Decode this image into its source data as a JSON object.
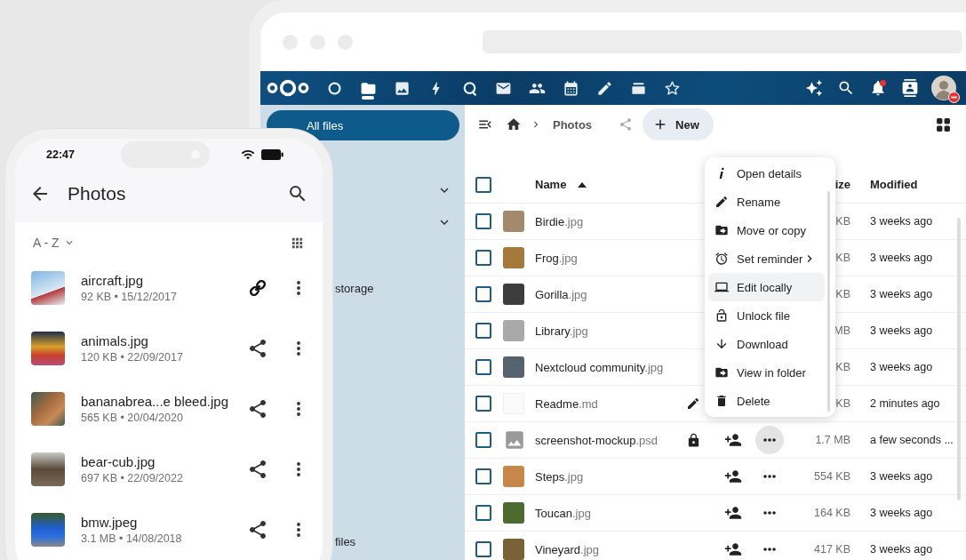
{
  "browser": {
    "header": {
      "apps": [
        {
          "selected": false
        },
        {
          "selected": true
        },
        {
          "selected": false
        },
        {
          "selected": false
        },
        {
          "selected": false
        },
        {
          "selected": false
        },
        {
          "selected": false
        },
        {
          "selected": false
        },
        {
          "selected": false
        },
        {
          "selected": false
        },
        {
          "selected": false
        }
      ],
      "notifications_unread": true,
      "do_not_disturb": true
    },
    "sidebar": {
      "items": [
        {
          "kind": "link",
          "label": "All files",
          "selected": true
        },
        {
          "kind": "group",
          "expanded": false,
          "selected": false
        },
        {
          "kind": "group",
          "expanded": false,
          "selected": false
        },
        {
          "kind": "link",
          "label": "storage",
          "selected": false
        },
        {
          "kind": "footer",
          "label": "files",
          "selected": false
        }
      ]
    },
    "toolbar": {
      "breadcrumb": "Photos",
      "new_button": "New"
    },
    "table": {
      "select_all": {
        "checked": false
      },
      "columns": [
        {
          "label": "Name",
          "sorted": true
        },
        {
          "label": "ize",
          "sorted": false
        },
        {
          "label": "Modified",
          "sorted": false
        }
      ],
      "rows": [
        {
          "checked": false,
          "kind": "photo",
          "name": "Birdie",
          "ext": ".jpg",
          "locked": false,
          "editing": false,
          "menu_open": false,
          "size": "KB",
          "modified": "3 weeks ago"
        },
        {
          "checked": false,
          "kind": "photo",
          "name": "Frog",
          "ext": ".jpg",
          "locked": false,
          "editing": false,
          "menu_open": false,
          "size": "KB",
          "modified": "3 weeks ago"
        },
        {
          "checked": false,
          "kind": "photo",
          "name": "Gorilla",
          "ext": ".jpg",
          "locked": false,
          "editing": false,
          "menu_open": false,
          "size": "KB",
          "modified": "3 weeks ago"
        },
        {
          "checked": false,
          "kind": "photo",
          "name": "Library",
          "ext": ".jpg",
          "locked": false,
          "editing": false,
          "menu_open": false,
          "size": "MB",
          "modified": "3 weeks ago"
        },
        {
          "checked": false,
          "kind": "photo",
          "name": "Nextcloud community",
          "ext": ".jpg",
          "locked": false,
          "editing": false,
          "menu_open": false,
          "size": "KB",
          "modified": "3 weeks ago"
        },
        {
          "checked": false,
          "kind": "document",
          "name": "Readme",
          "ext": ".md",
          "locked": false,
          "editing": true,
          "menu_open": false,
          "size": "KB",
          "modified": "2 minutes ago"
        },
        {
          "checked": false,
          "kind": "image",
          "name": "screenshot-mockup",
          "ext": ".psd",
          "locked": true,
          "editing": false,
          "menu_open": true,
          "size": "1.7 MB",
          "modified": "a few seconds ..."
        },
        {
          "checked": false,
          "kind": "photo",
          "name": "Steps",
          "ext": ".jpg",
          "locked": false,
          "editing": false,
          "menu_open": false,
          "size": "554 KB",
          "modified": "3 weeks ago"
        },
        {
          "checked": false,
          "kind": "photo",
          "name": "Toucan",
          "ext": ".jpg",
          "locked": false,
          "editing": false,
          "menu_open": false,
          "size": "164 KB",
          "modified": "3 weeks ago"
        },
        {
          "checked": false,
          "kind": "photo",
          "name": "Vineyard",
          "ext": ".jpg",
          "locked": false,
          "editing": false,
          "menu_open": false,
          "size": "417 KB",
          "modified": "3 weeks ago"
        }
      ]
    },
    "context_menu": {
      "items": [
        {
          "label": "Open details",
          "highlighted": false,
          "submenu": false
        },
        {
          "label": "Rename",
          "highlighted": false,
          "submenu": false
        },
        {
          "label": "Move or copy",
          "highlighted": false,
          "submenu": false
        },
        {
          "label": "Set reminder",
          "highlighted": false,
          "submenu": true
        },
        {
          "label": "Edit locally",
          "highlighted": true,
          "submenu": false
        },
        {
          "label": "Unlock file",
          "highlighted": false,
          "submenu": false
        },
        {
          "label": "Download",
          "highlighted": false,
          "submenu": false
        },
        {
          "label": "View in folder",
          "highlighted": false,
          "submenu": false
        },
        {
          "label": "Delete",
          "highlighted": false,
          "submenu": false
        }
      ]
    }
  },
  "phone": {
    "status_time": "22:47",
    "title": "Photos",
    "sort_label": "A - Z",
    "files": [
      {
        "name": "aircraft.jpg",
        "meta": "92 KB • 15/12/2017",
        "link_shared": true
      },
      {
        "name": "animals.jpg",
        "meta": "120 KB • 22/09/2017",
        "link_shared": false
      },
      {
        "name": "bananabrea...e bleed.jpg",
        "meta": "565 KB • 20/04/2020",
        "link_shared": false
      },
      {
        "name": "bear-cub.jpg",
        "meta": "697 KB • 22/09/2022",
        "link_shared": false
      },
      {
        "name": "bmw.jpeg",
        "meta": "3.1 MB • 14/08/2018",
        "link_shared": false
      }
    ]
  }
}
